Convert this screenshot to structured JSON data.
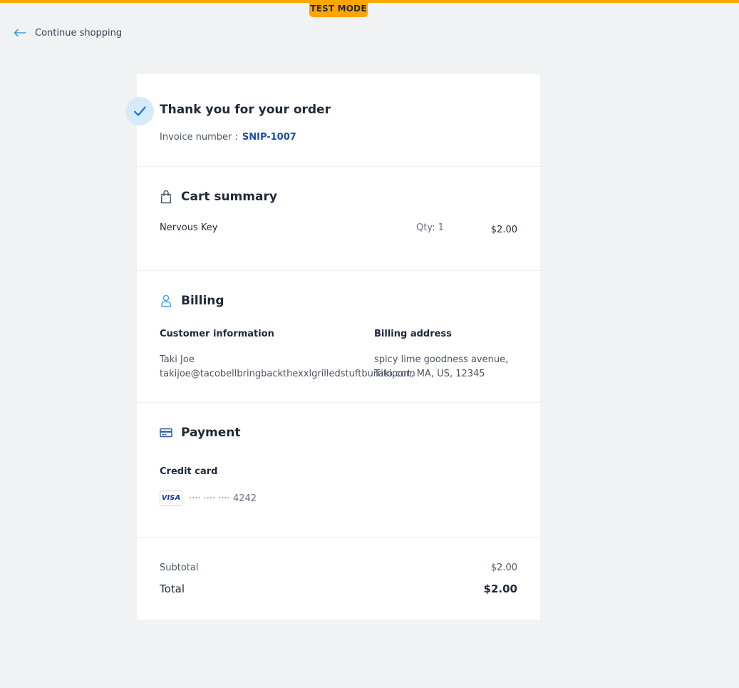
{
  "banner": {
    "test_mode": "TEST MODE",
    "accent_color": "#ffa500"
  },
  "nav": {
    "continue_label": "Continue shopping",
    "icon": "arrow-left-icon"
  },
  "confirmation": {
    "title": "Thank you for your order",
    "invoice_label": "Invoice number :",
    "invoice_number": "SNIP-1007",
    "icon": "checkmark-icon"
  },
  "cart": {
    "heading": "Cart summary",
    "icon": "shopping-bag-icon",
    "items": [
      {
        "name": "Nervous Key",
        "qty": "Qty: 1",
        "price": "$2.00"
      }
    ]
  },
  "billing": {
    "heading": "Billing",
    "icon": "user-icon",
    "customer_title": "Customer information",
    "customer_name": "Taki Joe",
    "customer_email": "takijoe@tacobellbringbackthexxlgrilledstuftburrito.com",
    "address_title": "Billing address",
    "address_line1": "spicy lime goodness avenue,",
    "address_line2": "Takiport, MA, US, 12345"
  },
  "payment": {
    "heading": "Payment",
    "icon": "credit-card-icon",
    "method": "Credit card",
    "card_brand": "VISA",
    "card_number": "···· ···· ···· 4242"
  },
  "totals": {
    "subtotal_label": "Subtotal",
    "subtotal_value": "$2.00",
    "total_label": "Total",
    "total_value": "$2.00"
  }
}
